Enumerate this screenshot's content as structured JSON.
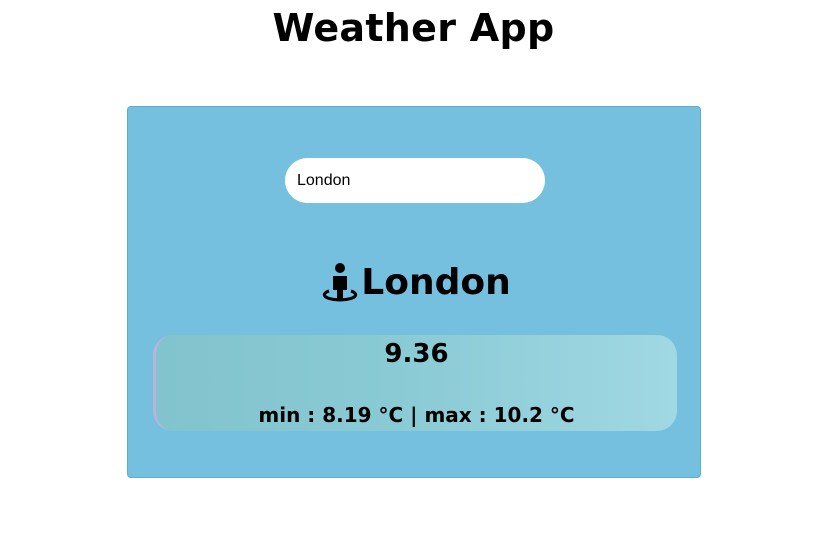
{
  "header": {
    "title": "Weather App"
  },
  "search": {
    "value": "London",
    "placeholder": ""
  },
  "weather": {
    "city": "London",
    "location_icon": "person-location-pin-icon",
    "temperature": "9.36",
    "min_max": "min : 8.19 °C | max : 10.2 °C"
  },
  "colors": {
    "card_background": "#75bfdf",
    "info_box_gradient_start": "#82c3cd",
    "info_box_gradient_end": "#a0d8e3",
    "search_background": "#ffffff",
    "text": "#000000"
  }
}
